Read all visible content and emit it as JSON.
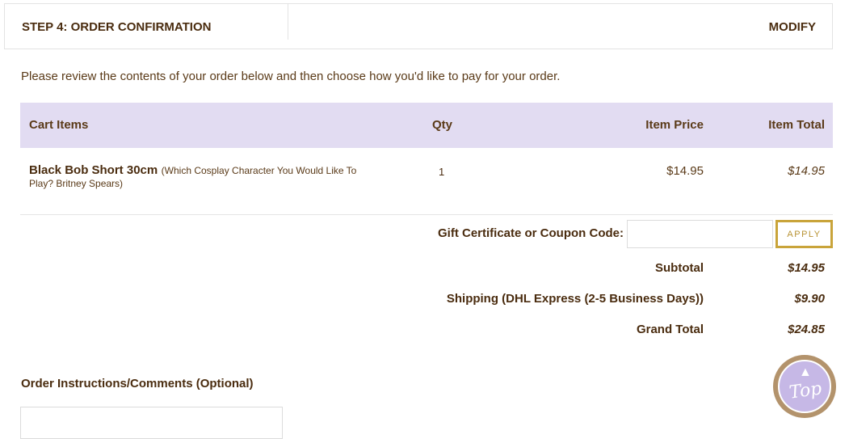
{
  "step": {
    "title": "STEP 4: ORDER CONFIRMATION",
    "modify_label": "MODIFY"
  },
  "intro_text": "Please review the contents of your order below and then choose how you'd like to pay for your order.",
  "cart": {
    "headers": {
      "items": "Cart Items",
      "qty": "Qty",
      "price": "Item Price",
      "total": "Item Total"
    },
    "rows": [
      {
        "name": "Black Bob Short 30cm",
        "attributes": "(Which Cosplay Character You Would Like To Play? Britney Spears)",
        "qty": "1",
        "price": "$14.95",
        "total": "$14.95"
      }
    ]
  },
  "coupon": {
    "label": "Gift Certificate or Coupon Code:",
    "value": "",
    "apply_label": "APPLY"
  },
  "summary": [
    {
      "label": "Subtotal",
      "value": "$14.95"
    },
    {
      "label": "Shipping (DHL Express (2-5 Business Days))",
      "value": "$9.90"
    },
    {
      "label": "Grand Total",
      "value": "$24.85"
    }
  ],
  "comments": {
    "label": "Order Instructions/Comments (Optional)",
    "value": ""
  },
  "top_button": {
    "arrow": "▲",
    "label": "Top"
  },
  "colors": {
    "accent_gold": "#c9a43a",
    "header_lavender": "#e2dcf2",
    "text_brown": "#4a2c0f"
  }
}
